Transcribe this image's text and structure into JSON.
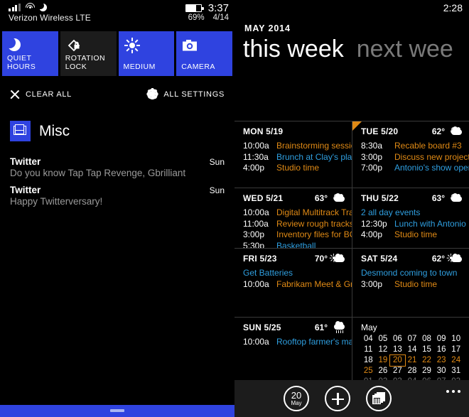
{
  "action_center": {
    "status_bar": {
      "carrier": "Verizon Wireless LTE",
      "time": "3:37",
      "battery_percent": "69%",
      "date": "4/14",
      "icons": [
        "signal-bars-icon",
        "wifi-icon",
        "moon-icon",
        "battery-icon"
      ]
    },
    "quick_tiles": [
      {
        "label": "QUIET HOURS",
        "icon": "moon-icon",
        "state": "on"
      },
      {
        "label": "ROTATION LOCK",
        "icon": "rotation-lock-icon",
        "state": "off"
      },
      {
        "label": "MEDIUM",
        "icon": "brightness-sun-icon",
        "state": "on"
      },
      {
        "label": "CAMERA",
        "icon": "camera-icon",
        "state": "on"
      }
    ],
    "clear_all_label": "CLEAR ALL",
    "all_settings_label": "ALL SETTINGS",
    "group": {
      "name": "Misc",
      "icon": "mail-icon"
    },
    "notifications": [
      {
        "title": "Twitter",
        "when": "Sun",
        "body": "Do you know Tap Tap Revenge, Gbrilliant"
      },
      {
        "title": "Twitter",
        "when": "Sun",
        "body": "Happy Twitterversary!"
      }
    ]
  },
  "calendar": {
    "status_time": "2:28",
    "month_label": "MAY 2014",
    "pivots": [
      {
        "label": "this week",
        "active": true
      },
      {
        "label": "next wee",
        "active": false
      }
    ],
    "weeks": [
      {
        "days": [
          {
            "name": "MON 5/19",
            "temp": "",
            "weather": "",
            "today": false,
            "events": [
              {
                "time": "10:00a",
                "title": "Brainstorming session",
                "color": "orange"
              },
              {
                "time": "11:30a",
                "title": "Brunch at Clay's place",
                "color": "blue"
              },
              {
                "time": "4:00p",
                "title": "Studio time",
                "color": "orange"
              }
            ]
          },
          {
            "name": "TUE 5/20",
            "temp": "62°",
            "weather": "cloudy-icon",
            "today": true,
            "events": [
              {
                "time": "8:30a",
                "title": "Recable board #3",
                "color": "orange"
              },
              {
                "time": "3:00p",
                "title": "Discuss new project",
                "color": "orange"
              },
              {
                "time": "7:00p",
                "title": "Antonio's show opening",
                "color": "blue"
              }
            ]
          }
        ]
      },
      {
        "days": [
          {
            "name": "WED 5/21",
            "temp": "63°",
            "weather": "cloudy-icon",
            "today": false,
            "events": [
              {
                "time": "10:00a",
                "title": "Digital Multitrack Training",
                "color": "orange"
              },
              {
                "time": "11:00a",
                "title": "Review rough tracks with",
                "color": "orange"
              },
              {
                "time": "3:00p",
                "title": "Inventory files for BC pro",
                "color": "orange"
              },
              {
                "time": "5:30p",
                "title": "Basketball",
                "color": "blue"
              }
            ]
          },
          {
            "name": "THU 5/22",
            "temp": "63°",
            "weather": "cloudy-icon",
            "today": false,
            "events": [
              {
                "time": "",
                "title": "2 all day events",
                "color": "blue"
              },
              {
                "time": "12:30p",
                "title": "Lunch with Antonio",
                "color": "blue"
              },
              {
                "time": "4:00p",
                "title": "Studio time",
                "color": "orange"
              }
            ]
          }
        ]
      },
      {
        "days": [
          {
            "name": "FRI 5/23",
            "temp": "70°",
            "weather": "partly-sunny-icon",
            "today": false,
            "events": [
              {
                "time": "",
                "title": "Get Batteries",
                "color": "blue"
              },
              {
                "time": "10:00a",
                "title": "Fabrikam Meet & Greet",
                "color": "orange"
              }
            ]
          },
          {
            "name": "SAT 5/24",
            "temp": "62°",
            "weather": "partly-sunny-icon",
            "today": false,
            "events": [
              {
                "time": "",
                "title": "Desmond coming to town",
                "color": "blue"
              },
              {
                "time": "3:00p",
                "title": "Studio time",
                "color": "orange"
              }
            ]
          }
        ]
      },
      {
        "days": [
          {
            "name": "SUN 5/25",
            "temp": "61°",
            "weather": "rain-icon",
            "today": false,
            "events": [
              {
                "time": "10:00a",
                "title": "Rooftop farmer's market",
                "color": "blue"
              }
            ]
          }
        ]
      }
    ],
    "mini_month": {
      "label": "May",
      "cells": [
        {
          "d": "04"
        },
        {
          "d": "05"
        },
        {
          "d": "06"
        },
        {
          "d": "07"
        },
        {
          "d": "08"
        },
        {
          "d": "09"
        },
        {
          "d": "10"
        },
        {
          "d": "11"
        },
        {
          "d": "12"
        },
        {
          "d": "13"
        },
        {
          "d": "14"
        },
        {
          "d": "15"
        },
        {
          "d": "16"
        },
        {
          "d": "17"
        },
        {
          "d": "18"
        },
        {
          "d": "19",
          "s": "ev"
        },
        {
          "d": "20",
          "s": "sel"
        },
        {
          "d": "21",
          "s": "ev"
        },
        {
          "d": "22",
          "s": "ev"
        },
        {
          "d": "23",
          "s": "ev"
        },
        {
          "d": "24",
          "s": "ev"
        },
        {
          "d": "25",
          "s": "ev"
        },
        {
          "d": "26"
        },
        {
          "d": "27"
        },
        {
          "d": "28"
        },
        {
          "d": "29"
        },
        {
          "d": "30"
        },
        {
          "d": "31"
        },
        {
          "d": "01",
          "s": "dim"
        },
        {
          "d": "02",
          "s": "dim"
        },
        {
          "d": "03",
          "s": "dim"
        },
        {
          "d": "04",
          "s": "dim"
        },
        {
          "d": "06",
          "s": "dim"
        },
        {
          "d": "07",
          "s": "dim"
        },
        {
          "d": "03",
          "s": "dim"
        }
      ]
    },
    "app_bar": {
      "buttons": [
        {
          "name": "today-button",
          "day": "20",
          "month": "May"
        },
        {
          "name": "new-event-button",
          "icon": "plus-icon"
        },
        {
          "name": "agenda-view-button",
          "icon": "calendar-stack-icon"
        }
      ],
      "more_icon": "ellipsis-icon"
    }
  },
  "colors": {
    "accent_blue": "#2f43e0",
    "event_orange": "#e08a15",
    "event_blue": "#2f9fe0",
    "background": "#000000",
    "appbar": "#1c1c1c"
  }
}
